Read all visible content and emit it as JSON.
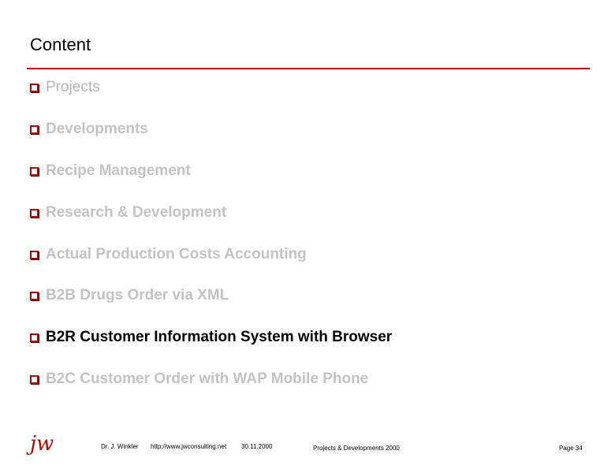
{
  "slide": {
    "title": "Content",
    "accent_color": "#c00000",
    "bullet_icon": "checkbox-square-icon",
    "items": [
      {
        "label": "Projects",
        "state": "dim"
      },
      {
        "label": "Developments",
        "state": "dim"
      },
      {
        "label": "Recipe Management",
        "state": "dim"
      },
      {
        "label": "Research & Development",
        "state": "dim"
      },
      {
        "label": "Actual Production Costs Accounting",
        "state": "dim"
      },
      {
        "label": "B2B Drugs Order via XML",
        "state": "dim"
      },
      {
        "label": "B2R Customer Information System with Browser",
        "state": "active"
      },
      {
        "label": "B2C Customer Order with  WAP Mobile Phone",
        "state": "dim"
      }
    ]
  },
  "footer": {
    "logo": "jw",
    "author": "Dr. J. Winkler",
    "url": "http://www.jwconsulting.net",
    "date": "30.11.2000",
    "doc_title": "Projects & Developments 2000",
    "page": "Page 34"
  }
}
